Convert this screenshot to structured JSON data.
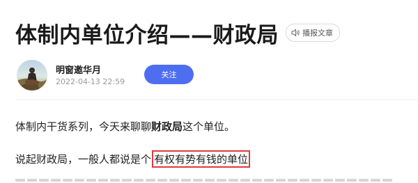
{
  "article": {
    "title": "体制内单位介绍——财政局",
    "listen_label": "播报文章"
  },
  "author": {
    "name": "明窗邀华月",
    "publish_time": "2022-04-13 22:59",
    "follow_label": "关注"
  },
  "body": {
    "p1_before": "体制内干货系列，今天来聊聊",
    "p1_bold": "财政局",
    "p1_after": "这个单位。",
    "p2_before": "说起财政局，一般人都说是个",
    "p2_highlight": "有权有势有钱的单位"
  },
  "colors": {
    "follow_button": "#4e6ef2",
    "highlight_border": "#e03a3a"
  },
  "icons": {
    "listen": "speaker-icon"
  }
}
